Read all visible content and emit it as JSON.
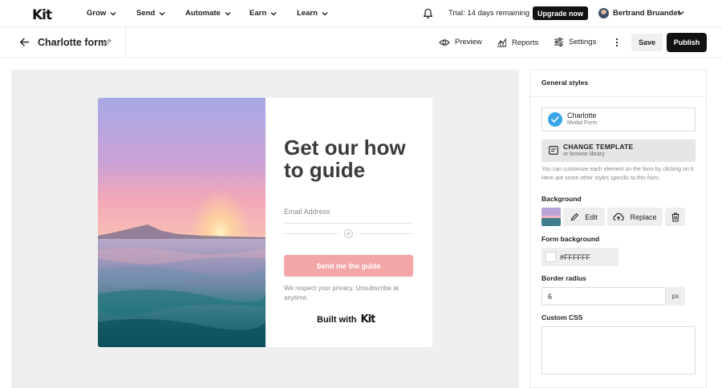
{
  "nav": {
    "logo": "Kit",
    "items": [
      {
        "label": "Grow"
      },
      {
        "label": "Send"
      },
      {
        "label": "Automate"
      },
      {
        "label": "Earn"
      },
      {
        "label": "Learn"
      }
    ],
    "trial_text": "Trial: 14 days remaining",
    "upgrade_label": "Upgrade now",
    "user_name": "Bertrand Bruandet"
  },
  "toolbar": {
    "form_title": "Charlotte form",
    "preview_label": "Preview",
    "reports_label": "Reports",
    "settings_label": "Settings",
    "save_label": "Save",
    "publish_label": "Publish"
  },
  "form_preview": {
    "headline": "Get our how to guide",
    "email_placeholder": "Email Address",
    "cta_label": "Send me the guide",
    "privacy_text": "We respect your privacy. Unsubscribe at anytime.",
    "built_with": "Built with",
    "built_with_brand": "Kit",
    "cta_color": "#f4a6a6"
  },
  "panel": {
    "title": "General styles",
    "template_name": "Charlotte",
    "template_type": "Modal Form",
    "change_template_label": "CHANGE TEMPLATE",
    "change_template_sub": "or browse library",
    "help_text": "You can customize each element on the form by clicking on it. Here are some other styles specific to this form.",
    "background_label": "Background",
    "edit_label": "Edit",
    "replace_label": "Replace",
    "form_background_label": "Form background",
    "form_background_value": "#FFFFFF",
    "border_radius_label": "Border radius",
    "border_radius_value": "6",
    "border_radius_unit": "px",
    "custom_css_label": "Custom CSS"
  },
  "colors": {
    "accent": "#111111",
    "check": "#3aa6e8"
  }
}
